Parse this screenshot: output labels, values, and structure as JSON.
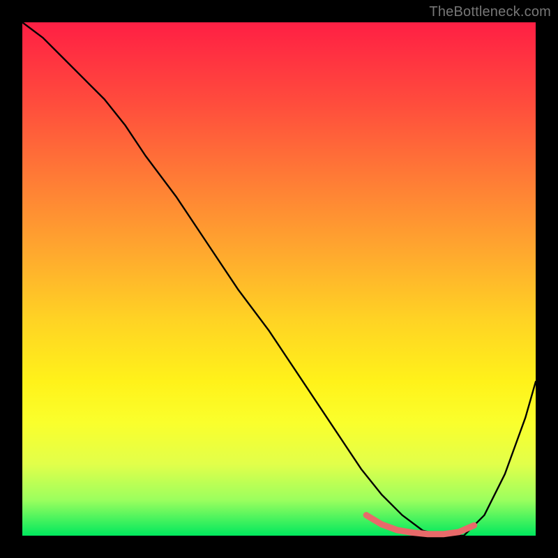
{
  "watermark": "TheBottleneck.com",
  "chart_data": {
    "type": "line",
    "title": "",
    "xlabel": "",
    "ylabel": "",
    "xlim": [
      0,
      100
    ],
    "ylim": [
      0,
      100
    ],
    "background_gradient": {
      "top": "#ff1f44",
      "bottom": "#00e85e"
    },
    "series": [
      {
        "name": "bottleneck-curve",
        "color": "#000000",
        "x": [
          0,
          4,
          8,
          12,
          16,
          20,
          24,
          30,
          36,
          42,
          48,
          54,
          60,
          66,
          70,
          74,
          78,
          82,
          86,
          90,
          94,
          98,
          100
        ],
        "y": [
          100,
          97,
          93,
          89,
          85,
          80,
          74,
          66,
          57,
          48,
          40,
          31,
          22,
          13,
          8,
          4,
          1,
          0,
          0,
          4,
          12,
          23,
          30
        ]
      },
      {
        "name": "optimal-region",
        "color": "#e86a6a",
        "x": [
          67,
          70,
          73,
          76,
          79,
          82,
          85,
          88
        ],
        "y": [
          4,
          2.2,
          1.1,
          0.6,
          0.3,
          0.3,
          0.7,
          2.0
        ]
      }
    ]
  }
}
